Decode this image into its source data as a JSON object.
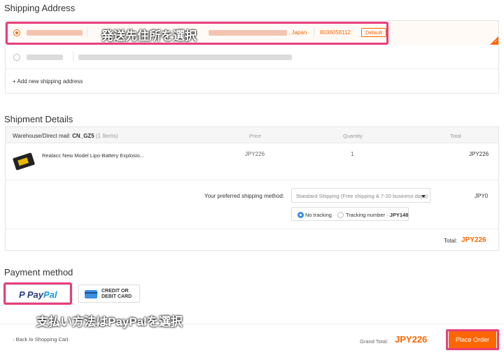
{
  "shipping_address": {
    "title": "Shipping Address",
    "addr1": {
      "country": ", Japan",
      "phone": "8036058112",
      "badge": "Default"
    },
    "add_new_label": "+ Add new shipping address"
  },
  "annotations": {
    "address": "発送先住所を選択",
    "payment": "支払い方法はPayPalを選択"
  },
  "shipment": {
    "title": "Shipment Details",
    "header": {
      "warehouse_label": "Warehouse/Direct mail:",
      "warehouse_code": "CN_GZ5",
      "items_count": "(1 Items)",
      "price": "Price",
      "quantity": "Quantity",
      "total": "Total"
    },
    "item": {
      "name": "Realacc New Model Lipo-Battery Explosio...",
      "price": "JPY226",
      "quantity": "1",
      "total": "JPY226"
    },
    "method_label": "Your preferred shipping method:",
    "method_value": "Standard Shipping (Free shipping & 7-20 business days)",
    "method_cost": "JPY0",
    "tracking": {
      "no_tracking": "No tracking",
      "tracking_number": "Tracking number",
      "tracking_price": "JPY148"
    },
    "total_label": "Total:",
    "total_value": "JPY226"
  },
  "payment": {
    "title": "Payment method",
    "paypal": {
      "pay": "Pay",
      "pal": "Pal"
    },
    "card_line1": "CREDIT OR",
    "card_line2": "DEBIT CARD"
  },
  "footer": {
    "back": "Back to Shopping Cart",
    "grand_total_label": "Grand Total:",
    "grand_total_value": "JPY226",
    "place_order": "Place Order"
  },
  "colors": {
    "accent": "#ff6600",
    "highlight": "#e83e7c",
    "paypal_dark": "#253b80",
    "paypal_light": "#179bd7"
  }
}
